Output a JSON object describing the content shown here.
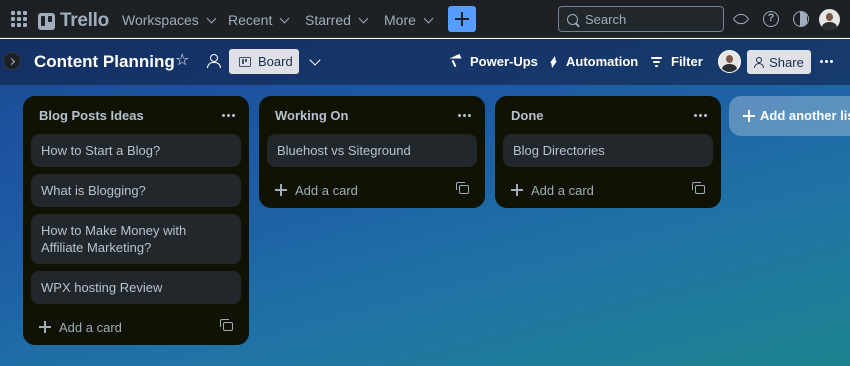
{
  "app": {
    "name": "Trello"
  },
  "topnav": {
    "menus": [
      {
        "label": "Workspaces"
      },
      {
        "label": "Recent"
      },
      {
        "label": "Starred"
      },
      {
        "label": "More"
      }
    ],
    "search_placeholder": "Search",
    "help_glyph": "?"
  },
  "board": {
    "title": "Content Planning",
    "star_glyph": "☆",
    "view_label": "Board",
    "actions": {
      "powerups": "Power-Ups",
      "automation": "Automation",
      "filter": "Filter",
      "share": "Share"
    },
    "add_list_label": "Add another list",
    "background_colors": [
      "#1b4a96",
      "#1f72a7",
      "#1d838f"
    ]
  },
  "lists": [
    {
      "title": "Blog Posts Ideas",
      "cards": [
        {
          "text": "How to Start a Blog?"
        },
        {
          "text": "What is Blogging?"
        },
        {
          "text": "How to Make Money with Affiliate Marketing?"
        },
        {
          "text": "WPX hosting Review"
        }
      ],
      "add_label": "Add a card"
    },
    {
      "title": "Working On",
      "cards": [
        {
          "text": "Bluehost vs Siteground"
        }
      ],
      "add_label": "Add a card"
    },
    {
      "title": "Done",
      "cards": [
        {
          "text": "Blog Directories"
        }
      ],
      "add_label": "Add a card"
    }
  ],
  "icons": [
    "apps-grid-icon",
    "trello-logo-icon",
    "chevron-down-icon",
    "plus-icon",
    "search-icon",
    "bell-icon",
    "help-icon",
    "theme-icon",
    "avatar",
    "sidebar-expand-icon",
    "star-icon",
    "workspace-visibility-icon",
    "board-view-icon",
    "rocket-icon",
    "bolt-icon",
    "filter-icon",
    "add-member-icon",
    "more-icon",
    "card-template-icon"
  ],
  "colors": {
    "accent": "#579dff",
    "list_bg": "#101204",
    "card_bg": "#22272b",
    "nav_bg": "#1d2125"
  }
}
